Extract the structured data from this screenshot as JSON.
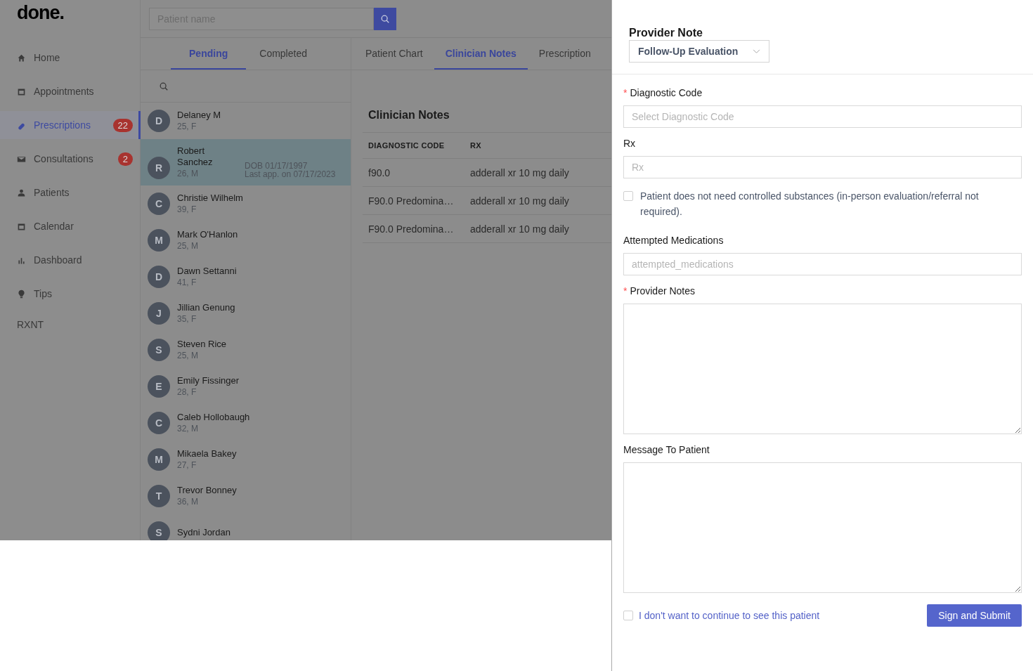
{
  "logo": "done.",
  "sidebar": {
    "items": [
      {
        "label": "Home",
        "selected": false
      },
      {
        "label": "Appointments",
        "selected": false
      },
      {
        "label": "Prescriptions",
        "badge": "22",
        "selected": true
      },
      {
        "label": "Consultations",
        "badge": "2",
        "selected": false
      },
      {
        "label": "Patients",
        "selected": false
      },
      {
        "label": "Calendar",
        "selected": false
      },
      {
        "label": "Dashboard",
        "selected": false
      },
      {
        "label": "Tips",
        "selected": false
      }
    ],
    "footer": "RXNT"
  },
  "search": {
    "placeholder": "Patient name"
  },
  "list_tabs": [
    {
      "label": "Pending",
      "selected": true
    },
    {
      "label": "Completed",
      "selected": false
    }
  ],
  "patients": [
    {
      "initial": "D",
      "name": "Delaney M",
      "info": "25, F",
      "selected": false
    },
    {
      "initial": "R",
      "name": "Robert Sanchez",
      "info": "26, M",
      "dob": "DOB 01/17/1997",
      "last_visit": "Last app. on 07/17/2023",
      "selected": true
    },
    {
      "initial": "C",
      "name": "Christie Wilhelm",
      "info": "39, F",
      "selected": false
    },
    {
      "initial": "M",
      "name": "Mark O'Hanlon",
      "info": "25, M",
      "selected": false
    },
    {
      "initial": "D",
      "name": "Dawn Settanni",
      "info": "41, F",
      "selected": false
    },
    {
      "initial": "J",
      "name": "Jillian Genung",
      "info": "35, F",
      "selected": false
    },
    {
      "initial": "S",
      "name": "Steven Rice",
      "info": "25, M",
      "selected": false
    },
    {
      "initial": "E",
      "name": "Emily Fissinger",
      "info": "28, F",
      "selected": false
    },
    {
      "initial": "C",
      "name": "Caleb Hollobaugh",
      "info": "32, M",
      "selected": false
    },
    {
      "initial": "M",
      "name": "Mikaela Bakey",
      "info": "27, F",
      "selected": false
    },
    {
      "initial": "T",
      "name": "Trevor Bonney",
      "info": "36, M",
      "selected": false
    },
    {
      "initial": "S",
      "name": "Sydni Jordan",
      "selected": false
    }
  ],
  "detail_tabs": [
    {
      "label": "Patient Chart",
      "selected": false
    },
    {
      "label": "Clinician Notes",
      "selected": true
    },
    {
      "label": "Prescription",
      "selected": false
    }
  ],
  "clinician_notes": {
    "title": "Clinician Notes",
    "columns": [
      "DIAGNOSTIC CODE",
      "RX"
    ],
    "rows": [
      [
        "f90.0",
        "adderall xr 10 mg daily"
      ],
      [
        "F90.0 Predomina…",
        "adderall xr 10 mg daily"
      ],
      [
        "F90.0 Predomina…",
        "adderall xr 10 mg daily"
      ]
    ]
  },
  "drawer": {
    "title": "Provider Note",
    "note_type": "Follow-Up Evaluation",
    "fields": [
      {
        "kind": "input",
        "label": "Diagnostic Code",
        "required_mark": "*",
        "placeholder": "Select Diagnostic Code"
      },
      {
        "kind": "input",
        "label": "Rx",
        "placeholder": "Rx"
      },
      {
        "kind": "checkbox",
        "label": "Patient does not need controlled substances (in-person evaluation/referral not required).",
        "checked": false
      },
      {
        "kind": "input",
        "label": "Attempted Medications",
        "placeholder": "attempted_medications"
      },
      {
        "kind": "textarea",
        "label": "Provider Notes",
        "required_mark": "*"
      },
      {
        "kind": "textarea",
        "label": "Message To Patient"
      }
    ],
    "opt_out": {
      "label": "I don't want to continue to see this patient",
      "checked": false
    },
    "submit": "Sign and Submit"
  }
}
